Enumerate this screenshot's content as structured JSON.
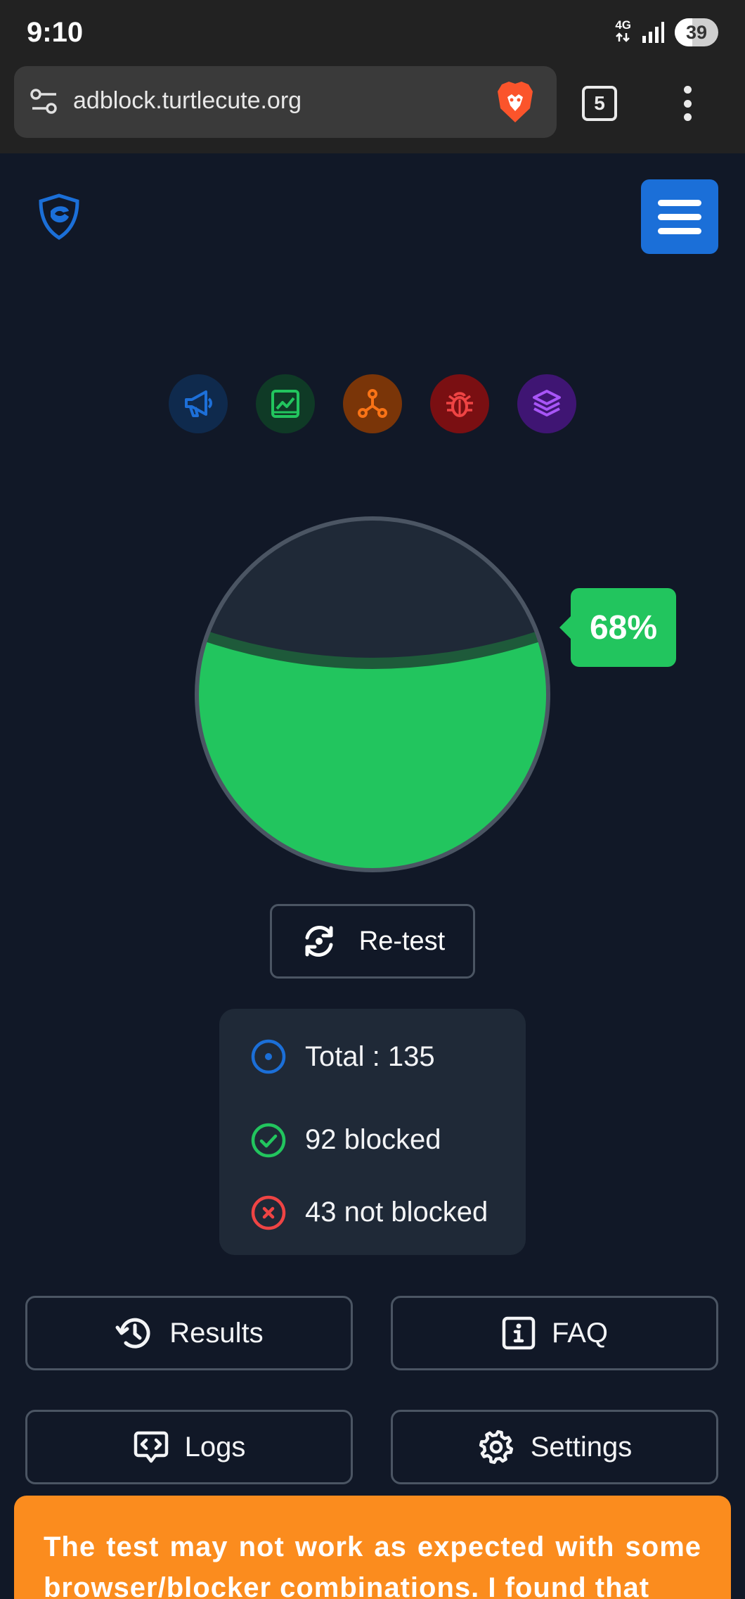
{
  "status_bar": {
    "time": "9:10",
    "network": "4G",
    "battery": "39"
  },
  "browser": {
    "url": "adblock.turtlecute.org",
    "tab_count": "5"
  },
  "categories": [
    {
      "name": "ads",
      "icon": "megaphone-icon",
      "color": "#1d6fd8",
      "bg": "#0f2a4d"
    },
    {
      "name": "analytics",
      "icon": "chart-icon",
      "color": "#22c55e",
      "bg": "#0f3a26"
    },
    {
      "name": "trackers",
      "icon": "network-icon",
      "color": "#f97316",
      "bg": "#7a3508"
    },
    {
      "name": "errors",
      "icon": "bug-icon",
      "color": "#ef4444",
      "bg": "#7a0f12"
    },
    {
      "name": "other",
      "icon": "layers-icon",
      "color": "#a855f7",
      "bg": "#3f1573"
    }
  ],
  "gauge": {
    "percent_label": "68%",
    "fill_fraction": 0.68
  },
  "retest_label": "Re-test",
  "stats": {
    "total": "Total : 135",
    "blocked": "92 blocked",
    "not_blocked": "43 not blocked"
  },
  "actions": {
    "results": "Results",
    "faq": "FAQ",
    "logs": "Logs",
    "settings": "Settings"
  },
  "warning": "The test may not work as expected with some browser/blocker combinations. I found that",
  "colors": {
    "background": "#111827",
    "accent": "#1b6fd8",
    "success": "#22c55e",
    "danger": "#ef4444",
    "warning": "#fb8c1e"
  }
}
